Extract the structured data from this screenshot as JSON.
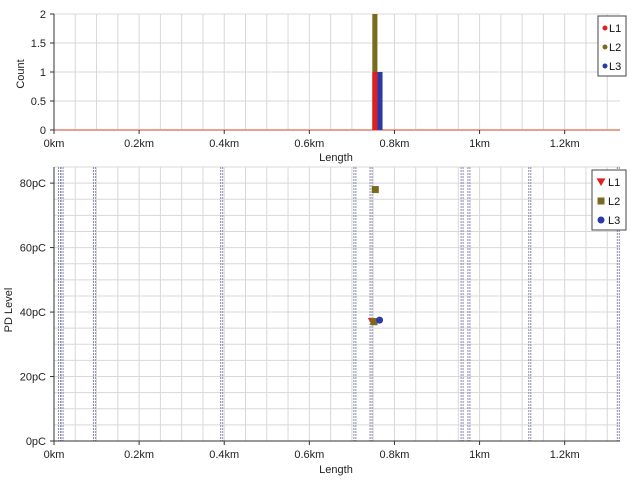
{
  "colors": {
    "L1": "#e02020",
    "L2": "#7a6a1e",
    "L3": "#2a3aa8",
    "grid": "#d8d8d8",
    "cable_line": "#8a8cb0",
    "baseline": "#e8a090"
  },
  "chart_data": [
    {
      "type": "bar",
      "xlabel": "Length",
      "ylabel": "Count",
      "xlim": [
        0,
        1.33
      ],
      "ylim": [
        0,
        2
      ],
      "x_ticks": [
        {
          "value": 0,
          "label": "0km"
        },
        {
          "value": 0.2,
          "label": "0.2km"
        },
        {
          "value": 0.4,
          "label": "0.4km"
        },
        {
          "value": 0.6,
          "label": "0.6km"
        },
        {
          "value": 0.8,
          "label": "0.8km"
        },
        {
          "value": 1.0,
          "label": "1km"
        },
        {
          "value": 1.2,
          "label": "1.2km"
        }
      ],
      "y_ticks": [
        {
          "value": 0,
          "label": "0"
        },
        {
          "value": 0.5,
          "label": "0.5"
        },
        {
          "value": 1,
          "label": "1"
        },
        {
          "value": 1.5,
          "label": "1.5"
        },
        {
          "value": 2,
          "label": "2"
        }
      ],
      "bars": [
        {
          "series": "L1",
          "x_start": 0.748,
          "x_end": 0.76,
          "count": 1
        },
        {
          "series": "L2",
          "x_start": 0.748,
          "x_end": 0.76,
          "count": 2
        },
        {
          "series": "L3",
          "x_start": 0.76,
          "x_end": 0.772,
          "count": 1
        }
      ],
      "legend": {
        "position": "top-right",
        "entries": [
          {
            "name": "L1",
            "marker": "dot"
          },
          {
            "name": "L2",
            "marker": "dot"
          },
          {
            "name": "L3",
            "marker": "dot"
          }
        ]
      }
    },
    {
      "type": "scatter",
      "xlabel": "Length",
      "ylabel": "PD Level",
      "xlim": [
        0,
        1.33
      ],
      "ylim": [
        0,
        85
      ],
      "x_ticks": [
        {
          "value": 0,
          "label": "0km"
        },
        {
          "value": 0.2,
          "label": "0.2km"
        },
        {
          "value": 0.4,
          "label": "0.4km"
        },
        {
          "value": 0.6,
          "label": "0.6km"
        },
        {
          "value": 0.8,
          "label": "0.8km"
        },
        {
          "value": 1.0,
          "label": "1km"
        },
        {
          "value": 1.2,
          "label": "1.2km"
        }
      ],
      "y_ticks": [
        {
          "value": 0,
          "label": "0pC"
        },
        {
          "value": 20,
          "label": "20pC"
        },
        {
          "value": 40,
          "label": "40pC"
        },
        {
          "value": 60,
          "label": "60pC"
        },
        {
          "value": 80,
          "label": "80pC"
        }
      ],
      "vertical_lines_km": [
        0.013,
        0.019,
        0.095,
        0.394,
        0.707,
        0.745,
        0.959,
        0.975,
        1.118,
        1.326
      ],
      "series": [
        {
          "name": "L1",
          "marker": "triangle-down",
          "points": [
            {
              "x": 0.748,
              "y": 37
            }
          ]
        },
        {
          "name": "L2",
          "marker": "square",
          "points": [
            {
              "x": 0.755,
              "y": 78
            },
            {
              "x": 0.752,
              "y": 37
            }
          ]
        },
        {
          "name": "L3",
          "marker": "circle",
          "points": [
            {
              "x": 0.765,
              "y": 37.5
            }
          ]
        }
      ],
      "legend": {
        "position": "top-right",
        "entries": [
          {
            "name": "L1",
            "marker": "triangle-down"
          },
          {
            "name": "L2",
            "marker": "square"
          },
          {
            "name": "L3",
            "marker": "circle"
          }
        ]
      }
    }
  ]
}
